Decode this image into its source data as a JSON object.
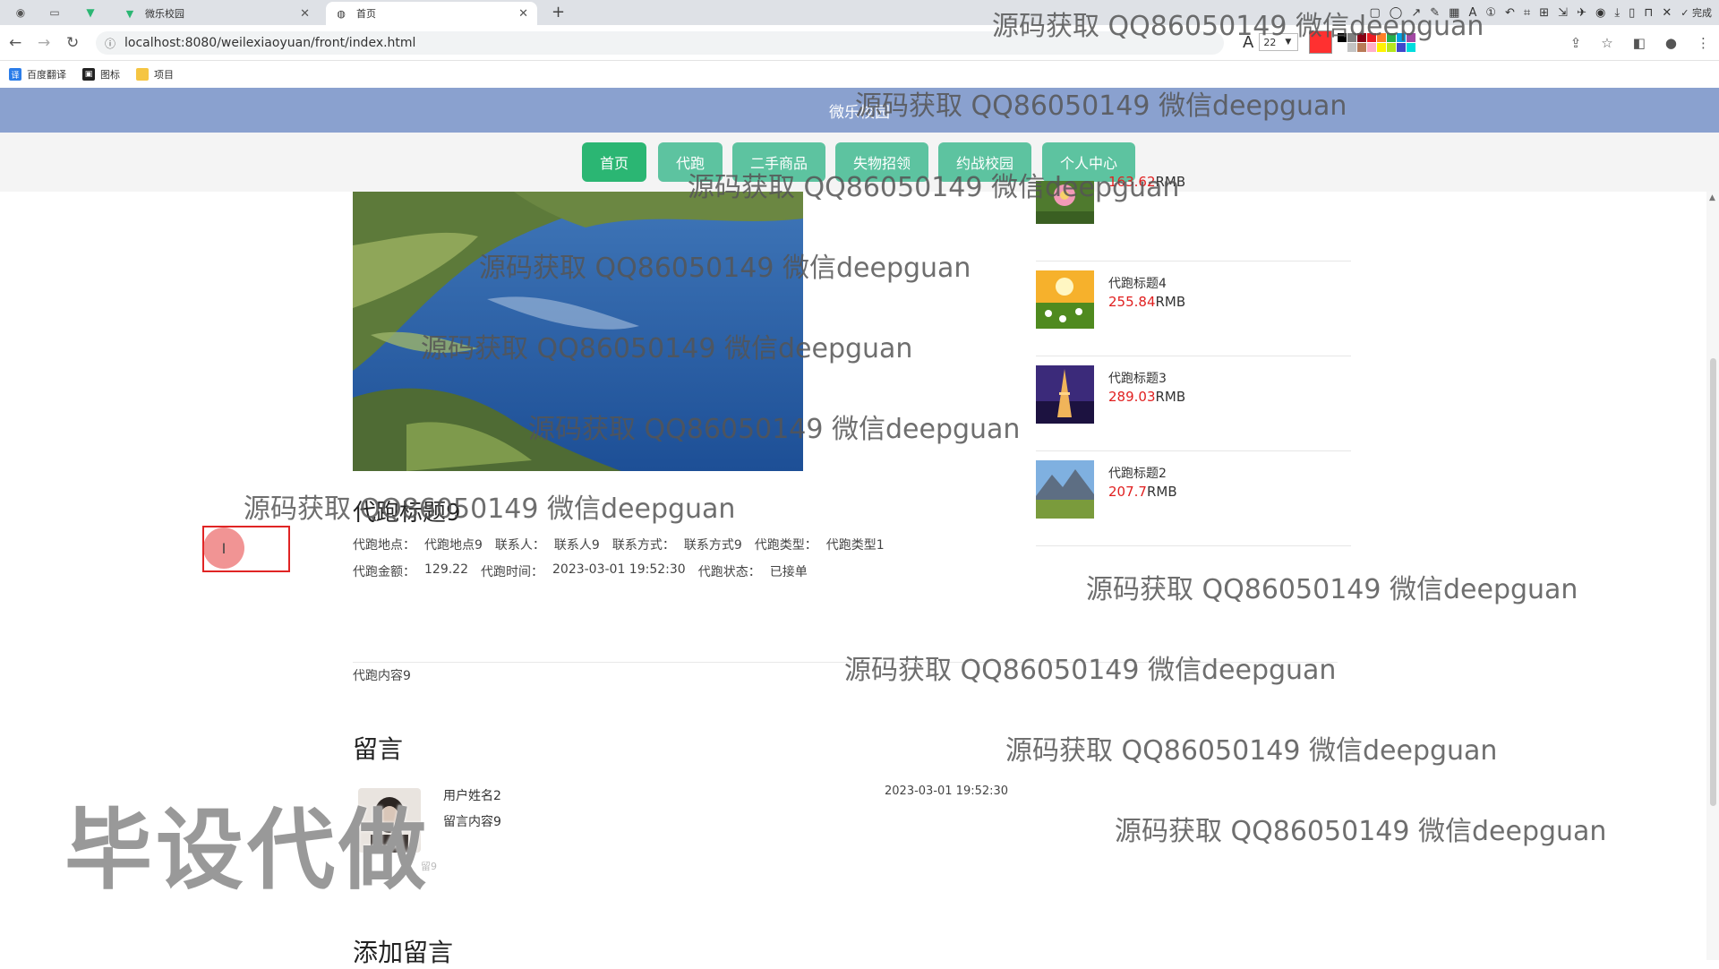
{
  "browser": {
    "tabs": [
      {
        "label": "微乐校园",
        "close": "✕"
      },
      {
        "label": "首页",
        "close": "✕"
      }
    ],
    "new_tab": "+",
    "url": "localhost:8080/weilexiaoyuan/front/index.html",
    "bookmarks": [
      "百度翻译",
      "图标",
      "项目"
    ],
    "done_label": "完成",
    "font_size": "22",
    "pen_colors": [
      "#000000",
      "#7f7f7f",
      "#880015",
      "#ed1c24",
      "#ff7f27",
      "#22b14c",
      "#00a2e8",
      "#a349a4",
      "#ffffff",
      "#c3c3c3",
      "#b97a57",
      "#ffaec9",
      "#fff200",
      "#b5e61d",
      "#3f48cc",
      "#00dddd"
    ]
  },
  "site": {
    "title": "微乐校园",
    "nav": [
      "首页",
      "代跑",
      "二手商品",
      "失物招领",
      "约战校园",
      "个人中心"
    ]
  },
  "detail": {
    "title": "代跑标题9",
    "fields_row1": [
      {
        "label": "代跑地点：",
        "value": "代跑地点9"
      },
      {
        "label": "联系人：",
        "value": "联系人9"
      },
      {
        "label": "联系方式：",
        "value": "联系方式9"
      },
      {
        "label": "代跑类型：",
        "value": "代跑类型1"
      }
    ],
    "fields_row2": [
      {
        "label": "代跑金额：",
        "value": "129.22"
      },
      {
        "label": "代跑时间：",
        "value": "2023-03-01 19:52:30"
      },
      {
        "label": "代跑状态：",
        "value": "已接单"
      }
    ],
    "content": "代跑内容9"
  },
  "comments": {
    "title": "留言",
    "items": [
      {
        "user": "用户姓名2",
        "text": "留言内容9",
        "time": "2023-03-01 19:52:30",
        "faded": "留9"
      }
    ],
    "add_title": "添加留言"
  },
  "side_list": [
    {
      "name": "",
      "price": "163.62",
      "unit": "RMB"
    },
    {
      "name": "代跑标题4",
      "price": "255.84",
      "unit": "RMB"
    },
    {
      "name": "代跑标题3",
      "price": "289.03",
      "unit": "RMB"
    },
    {
      "name": "代跑标题2",
      "price": "207.7",
      "unit": "RMB"
    }
  ],
  "watermark": "源码获取 QQ86050149 微信deepguan",
  "big_watermark": "毕设代做",
  "cursor_glyph": "I"
}
